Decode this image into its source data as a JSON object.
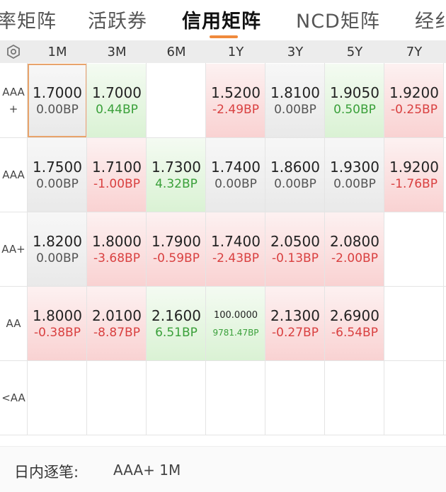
{
  "tabs": [
    {
      "label": "率矩阵",
      "active": false
    },
    {
      "label": "活跃券",
      "active": false
    },
    {
      "label": "信用矩阵",
      "active": true
    },
    {
      "label": "NCD矩阵",
      "active": false
    },
    {
      "label": "经纟",
      "active": false
    }
  ],
  "matrix": {
    "settings_icon": "hexagon-gear-icon",
    "columns": [
      "1M",
      "3M",
      "6M",
      "1Y",
      "3Y",
      "5Y",
      "7Y"
    ],
    "rows": [
      {
        "label_line1": "AAA",
        "label_line2": "+",
        "cells": [
          {
            "yield": "1.7000",
            "change": "0.00BP",
            "tone": "gray",
            "selected": true
          },
          {
            "yield": "1.7000",
            "change": "0.44BP",
            "tone": "green"
          },
          {
            "yield": "",
            "change": "",
            "tone": "empty"
          },
          {
            "yield": "1.5200",
            "change": "-2.49BP",
            "tone": "red"
          },
          {
            "yield": "1.8100",
            "change": "0.00BP",
            "tone": "gray"
          },
          {
            "yield": "1.9050",
            "change": "0.50BP",
            "tone": "green"
          },
          {
            "yield": "1.9200",
            "change": "-0.25BP",
            "tone": "red"
          }
        ]
      },
      {
        "label_line1": "AAA",
        "label_line2": "",
        "cells": [
          {
            "yield": "1.7500",
            "change": "0.00BP",
            "tone": "gray"
          },
          {
            "yield": "1.7100",
            "change": "-1.00BP",
            "tone": "red"
          },
          {
            "yield": "1.7300",
            "change": "4.32BP",
            "tone": "green"
          },
          {
            "yield": "1.7400",
            "change": "0.00BP",
            "tone": "gray"
          },
          {
            "yield": "1.8600",
            "change": "0.00BP",
            "tone": "gray"
          },
          {
            "yield": "1.9300",
            "change": "0.00BP",
            "tone": "gray"
          },
          {
            "yield": "1.9200",
            "change": "-1.76BP",
            "tone": "red"
          }
        ]
      },
      {
        "label_line1": "AA+",
        "label_line2": "",
        "cells": [
          {
            "yield": "1.8200",
            "change": "0.00BP",
            "tone": "gray"
          },
          {
            "yield": "1.8000",
            "change": "-3.68BP",
            "tone": "red"
          },
          {
            "yield": "1.7900",
            "change": "-0.59BP",
            "tone": "red"
          },
          {
            "yield": "1.7400",
            "change": "-2.43BP",
            "tone": "red"
          },
          {
            "yield": "2.0500",
            "change": "-0.13BP",
            "tone": "red"
          },
          {
            "yield": "2.0800",
            "change": "-2.00BP",
            "tone": "red"
          },
          {
            "yield": "",
            "change": "",
            "tone": "empty"
          }
        ]
      },
      {
        "label_line1": "AA",
        "label_line2": "",
        "cells": [
          {
            "yield": "1.8000",
            "change": "-0.38BP",
            "tone": "red"
          },
          {
            "yield": "2.0100",
            "change": "-8.87BP",
            "tone": "red"
          },
          {
            "yield": "2.1600",
            "change": "6.51BP",
            "tone": "green"
          },
          {
            "yield": "100.0000",
            "change": "9781.47BP",
            "tone": "green",
            "small": true
          },
          {
            "yield": "2.1300",
            "change": "-0.27BP",
            "tone": "red"
          },
          {
            "yield": "2.6900",
            "change": "-6.54BP",
            "tone": "red"
          },
          {
            "yield": "",
            "change": "",
            "tone": "empty"
          }
        ]
      },
      {
        "label_line1": "<AA",
        "label_line2": "",
        "cells": [
          {
            "yield": "",
            "change": "",
            "tone": "empty"
          },
          {
            "yield": "",
            "change": "",
            "tone": "empty"
          },
          {
            "yield": "",
            "change": "",
            "tone": "empty"
          },
          {
            "yield": "",
            "change": "",
            "tone": "empty"
          },
          {
            "yield": "",
            "change": "",
            "tone": "empty"
          },
          {
            "yield": "",
            "change": "",
            "tone": "empty"
          },
          {
            "yield": "",
            "change": "",
            "tone": "empty"
          }
        ]
      }
    ]
  },
  "footer": {
    "label": "日内逐笔:",
    "value": "AAA+ 1M"
  },
  "colors": {
    "accent": "#f08a3c",
    "up_red": "#d94040",
    "down_green": "#3aa03a",
    "selected_border": "#e8a36b"
  }
}
